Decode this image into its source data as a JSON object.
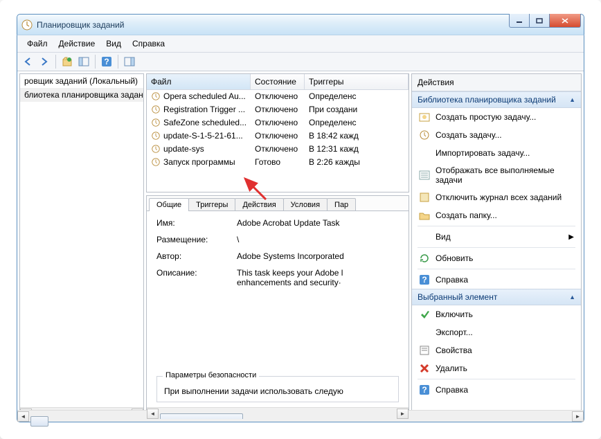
{
  "title": "Планировщик заданий",
  "menus": {
    "file": "Файл",
    "action": "Действие",
    "view": "Вид",
    "help": "Справка"
  },
  "tree": {
    "node0": "ровщик заданий (Локальный)",
    "node1": "блиотека планировщика задан"
  },
  "columns": {
    "name": "Файл",
    "state": "Состояние",
    "triggers": "Триггеры"
  },
  "tasks": [
    {
      "name": "Opera scheduled Au...",
      "state": "Отключено",
      "trigger": "Определенс"
    },
    {
      "name": "Registration Trigger ...",
      "state": "Отключено",
      "trigger": "При создани"
    },
    {
      "name": "SafeZone scheduled...",
      "state": "Отключено",
      "trigger": "Определенс"
    },
    {
      "name": "update-S-1-5-21-61...",
      "state": "Отключено",
      "trigger": "В 18:42 кажд"
    },
    {
      "name": "update-sys",
      "state": "Отключено",
      "trigger": "В 12:31 кажд"
    },
    {
      "name": "Запуск программы",
      "state": "Готово",
      "trigger": "В 2:26 кажды"
    }
  ],
  "tabs": {
    "general": "Общие",
    "triggers": "Триггеры",
    "actions": "Действия",
    "conditions": "Условия",
    "params": "Пар"
  },
  "details": {
    "name_lbl": "Имя:",
    "name_val": "Adobe Acrobat Update Task",
    "loc_lbl": "Размещение:",
    "loc_val": "\\",
    "author_lbl": "Автор:",
    "author_val": "Adobe Systems Incorporated",
    "desc_lbl": "Описание:",
    "desc_val": "This task keeps your Adobe l\nenhancements and security·",
    "sec_title": "Параметры безопасности",
    "sec_row": "При выполнении задачи использовать следую"
  },
  "actions": {
    "title": "Действия",
    "lib_header": "Библиотека планировщика заданий",
    "create_basic": "Создать простую задачу...",
    "create": "Создать задачу...",
    "import": "Импортировать задачу...",
    "show_running": "Отображать все выполняемые задачи",
    "disable_log": "Отключить журнал всех заданий",
    "new_folder": "Создать папку...",
    "view": "Вид",
    "refresh": "Обновить",
    "help": "Справка",
    "sel_header": "Выбранный элемент",
    "enable": "Включить",
    "export": "Экспорт...",
    "properties": "Свойства",
    "delete": "Удалить",
    "help2": "Справка"
  }
}
